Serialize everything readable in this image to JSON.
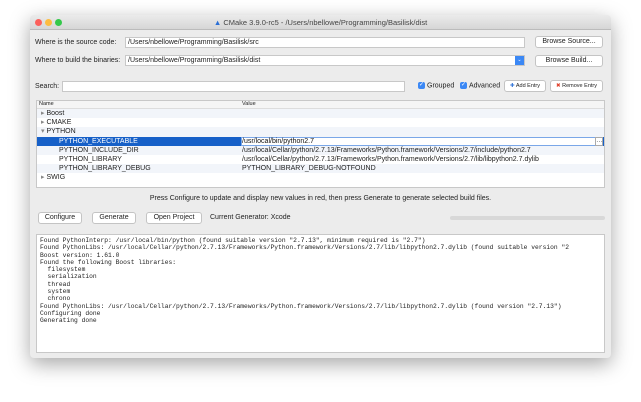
{
  "window": {
    "title": "CMake 3.9.0-rc5 - /Users/nbellowe/Programming/Basilisk/dist"
  },
  "paths": {
    "source_label": "Where is the source code:",
    "source_value": "/Users/nbellowe/Programming/Basilisk/src",
    "browse_source": "Browse Source...",
    "build_label": "Where to build the binaries:",
    "build_value": "/Users/nbellowe/Programming/Basilisk/dist",
    "browse_build": "Browse Build..."
  },
  "search": {
    "label": "Search:",
    "value": "",
    "grouped": "Grouped",
    "advanced": "Advanced",
    "add_entry": "Add Entry",
    "remove_entry": "Remove Entry"
  },
  "table": {
    "headers": [
      "Name",
      "Value"
    ],
    "rows": [
      {
        "name": "Boost",
        "value": "",
        "group": true,
        "expanded": false
      },
      {
        "name": "CMAKE",
        "value": "",
        "group": true,
        "expanded": false
      },
      {
        "name": "PYTHON",
        "value": "",
        "group": true,
        "expanded": true
      },
      {
        "name": "PYTHON_EXECUTABLE",
        "value": "/usr/local/bin/python2.7",
        "selected": true
      },
      {
        "name": "PYTHON_INCLUDE_DIR",
        "value": "/usr/local/Cellar/python/2.7.13/Frameworks/Python.framework/Versions/2.7/include/python2.7"
      },
      {
        "name": "PYTHON_LIBRARY",
        "value": "/usr/local/Cellar/python/2.7.13/Frameworks/Python.framework/Versions/2.7/lib/libpython2.7.dylib"
      },
      {
        "name": "PYTHON_LIBRARY_DEBUG",
        "value": "PYTHON_LIBRARY_DEBUG-NOTFOUND"
      },
      {
        "name": "SWIG",
        "value": "",
        "group": true,
        "expanded": false
      }
    ]
  },
  "message": "Press Configure to update and display new values in red, then press Generate to generate selected build files.",
  "actions": {
    "configure": "Configure",
    "generate": "Generate",
    "open_project": "Open Project",
    "generator": "Current Generator: Xcode"
  },
  "output": [
    "Found PythonInterp: /usr/local/bin/python (found suitable version \"2.7.13\", minimum required is \"2.7\")",
    "Found PythonLibs: /usr/local/Cellar/python/2.7.13/Frameworks/Python.framework/Versions/2.7/lib/libpython2.7.dylib (found suitable version \"2",
    "Boost version: 1.61.0",
    "Found the following Boost libraries:",
    "  filesystem",
    "  serialization",
    "  thread",
    "  system",
    "  chrono",
    "Found PythonLibs: /usr/local/Cellar/python/2.7.13/Frameworks/Python.framework/Versions/2.7/lib/libpython2.7.dylib (found version \"2.7.13\")",
    "Configuring done",
    "Generating done"
  ]
}
